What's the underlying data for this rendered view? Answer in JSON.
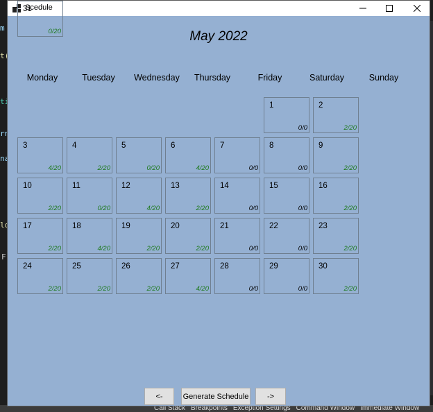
{
  "window": {
    "title": "Scedule"
  },
  "calendar": {
    "month_title": "May 2022",
    "weekdays": [
      "Monday",
      "Tuesday",
      "Wednesday",
      "Thursday",
      "Friday",
      "Saturday",
      "Sunday"
    ],
    "days": [
      {
        "day": "1",
        "count": "0/0",
        "status": "empty"
      },
      {
        "day": "2",
        "count": "2/20",
        "status": "available"
      },
      {
        "day": "3",
        "count": "4/20",
        "status": "available"
      },
      {
        "day": "4",
        "count": "2/20",
        "status": "available"
      },
      {
        "day": "5",
        "count": "0/20",
        "status": "available"
      },
      {
        "day": "6",
        "count": "4/20",
        "status": "available"
      },
      {
        "day": "7",
        "count": "0/0",
        "status": "empty"
      },
      {
        "day": "8",
        "count": "0/0",
        "status": "empty"
      },
      {
        "day": "9",
        "count": "2/20",
        "status": "available"
      },
      {
        "day": "10",
        "count": "2/20",
        "status": "available"
      },
      {
        "day": "11",
        "count": "0/20",
        "status": "available"
      },
      {
        "day": "12",
        "count": "4/20",
        "status": "available"
      },
      {
        "day": "13",
        "count": "2/20",
        "status": "available"
      },
      {
        "day": "14",
        "count": "0/0",
        "status": "empty"
      },
      {
        "day": "15",
        "count": "0/0",
        "status": "empty"
      },
      {
        "day": "16",
        "count": "2/20",
        "status": "available"
      },
      {
        "day": "17",
        "count": "2/20",
        "status": "available"
      },
      {
        "day": "18",
        "count": "4/20",
        "status": "available"
      },
      {
        "day": "19",
        "count": "2/20",
        "status": "available"
      },
      {
        "day": "20",
        "count": "2/20",
        "status": "available"
      },
      {
        "day": "21",
        "count": "0/0",
        "status": "empty"
      },
      {
        "day": "22",
        "count": "0/0",
        "status": "empty"
      },
      {
        "day": "23",
        "count": "2/20",
        "status": "available"
      },
      {
        "day": "24",
        "count": "2/20",
        "status": "available"
      },
      {
        "day": "25",
        "count": "2/20",
        "status": "available"
      },
      {
        "day": "26",
        "count": "2/20",
        "status": "available"
      },
      {
        "day": "27",
        "count": "4/20",
        "status": "available"
      },
      {
        "day": "28",
        "count": "0/0",
        "status": "empty"
      },
      {
        "day": "29",
        "count": "0/0",
        "status": "empty"
      },
      {
        "day": "30",
        "count": "2/20",
        "status": "available"
      },
      {
        "day": "31",
        "count": "0/20",
        "status": "available"
      }
    ],
    "first_weekday_index": 5
  },
  "buttons": {
    "prev": "<-",
    "generate": "Generate Schedule",
    "next": "->"
  },
  "background_ide": {
    "status_items": [
      "Call Stack",
      "Breakpoints",
      "Exception Settings",
      "Command Window",
      "Immediate Window"
    ]
  },
  "colors": {
    "window_bg": "#95b0d2",
    "count_available": "#1e7a1e",
    "count_empty": "#000000"
  }
}
